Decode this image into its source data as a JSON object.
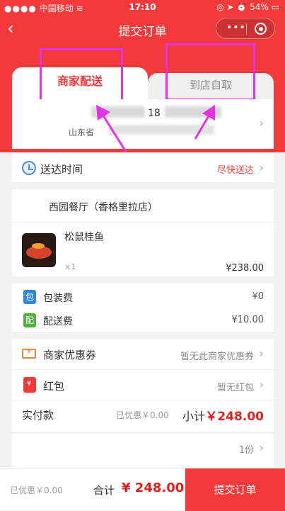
{
  "status_bar": {
    "carrier": "中国移动",
    "time": "17:10",
    "battery": "54%"
  },
  "navbar": {
    "title": "提交订单",
    "back_icon": "chevron-left-icon",
    "more_icon": "more-dots-icon",
    "close_icon": "target-icon"
  },
  "tabs": [
    {
      "label": "商家配送",
      "selected": true
    },
    {
      "label": "到店自取",
      "selected": false
    }
  ],
  "address": {
    "phone_prefix": "18",
    "region": "山东省"
  },
  "delivery": {
    "label": "送达时间",
    "value": "尽快送达"
  },
  "shop": {
    "name": "西园餐厅（香格里拉店）"
  },
  "item": {
    "name": "松鼠桂鱼",
    "qty": "×1",
    "price": "¥238.00"
  },
  "fees": [
    {
      "icon_text": "包",
      "label": "包装费",
      "value": "¥0",
      "color": "#2f86d6"
    },
    {
      "icon_text": "配",
      "label": "配送费",
      "value": "¥10.00",
      "color": "#52b043"
    }
  ],
  "promos": [
    {
      "icon": "coupon-icon",
      "label": "商家优惠券",
      "value": "暂无此商家优惠券"
    },
    {
      "icon": "red-packet-icon",
      "label": "红包",
      "value": "暂无红包"
    }
  ],
  "payment": {
    "label": "实付款",
    "discount": "已优惠￥0.00",
    "subtotal_label": "小计",
    "subtotal": "￥248.00"
  },
  "copies": "1份",
  "bottom": {
    "discount": "已优惠￥0.00",
    "total_label": "合计",
    "total": "¥ 248.00",
    "submit": "提交订单"
  },
  "colors": {
    "primary": "#f23a3a",
    "highlight": "#e632e6"
  }
}
